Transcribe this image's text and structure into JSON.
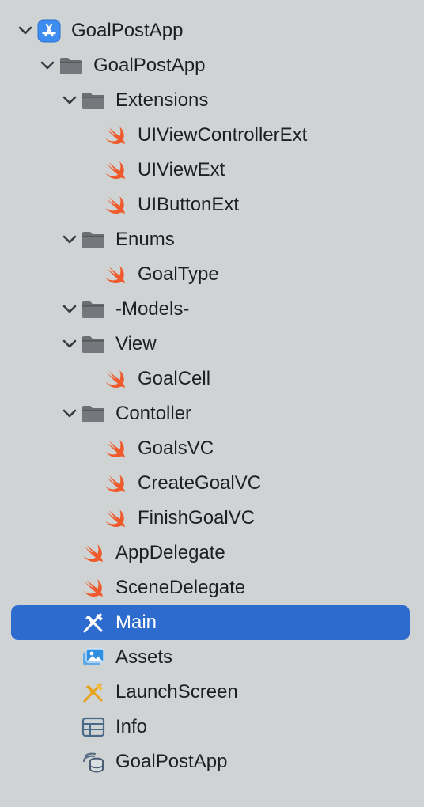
{
  "tree": [
    {
      "label": "GoalPostApp",
      "icon": "app-project-icon",
      "depth": 0,
      "expandable": true,
      "expanded": true
    },
    {
      "label": "GoalPostApp",
      "icon": "folder-icon",
      "depth": 1,
      "expandable": true,
      "expanded": true
    },
    {
      "label": "Extensions",
      "icon": "folder-icon",
      "depth": 2,
      "expandable": true,
      "expanded": true
    },
    {
      "label": "UIViewControllerExt",
      "icon": "swift-icon",
      "depth": 3
    },
    {
      "label": "UIViewExt",
      "icon": "swift-icon",
      "depth": 3
    },
    {
      "label": "UIButtonExt",
      "icon": "swift-icon",
      "depth": 3
    },
    {
      "label": "Enums",
      "icon": "folder-icon",
      "depth": 2,
      "expandable": true,
      "expanded": true
    },
    {
      "label": "GoalType",
      "icon": "swift-icon",
      "depth": 3
    },
    {
      "label": "-Models-",
      "icon": "folder-icon",
      "depth": 2,
      "expandable": true,
      "expanded": true
    },
    {
      "label": "View",
      "icon": "folder-icon",
      "depth": 2,
      "expandable": true,
      "expanded": true
    },
    {
      "label": "GoalCell",
      "icon": "swift-icon",
      "depth": 3
    },
    {
      "label": "Contoller",
      "icon": "folder-icon",
      "depth": 2,
      "expandable": true,
      "expanded": true
    },
    {
      "label": "GoalsVC",
      "icon": "swift-icon",
      "depth": 3
    },
    {
      "label": "CreateGoalVC",
      "icon": "swift-icon",
      "depth": 3
    },
    {
      "label": "FinishGoalVC",
      "icon": "swift-icon",
      "depth": 3
    },
    {
      "label": "AppDelegate",
      "icon": "swift-icon",
      "depth": 2
    },
    {
      "label": "SceneDelegate",
      "icon": "swift-icon",
      "depth": 2
    },
    {
      "label": "Main",
      "icon": "storyboard-icon",
      "depth": 2,
      "selected": true
    },
    {
      "label": "Assets",
      "icon": "asset-catalog-icon",
      "depth": 2
    },
    {
      "label": "LaunchScreen",
      "icon": "storyboard-icon",
      "depth": 2
    },
    {
      "label": "Info",
      "icon": "plist-icon",
      "depth": 2
    },
    {
      "label": "GoalPostApp",
      "icon": "data-model-icon",
      "depth": 2
    }
  ],
  "colors": {
    "background": "#cfd3d4",
    "selection": "#2e6bcf",
    "text": "#1f1f21",
    "folder": "#6c6e72",
    "swift": "#ee5a2b",
    "chevron": "#3a3b3d"
  }
}
